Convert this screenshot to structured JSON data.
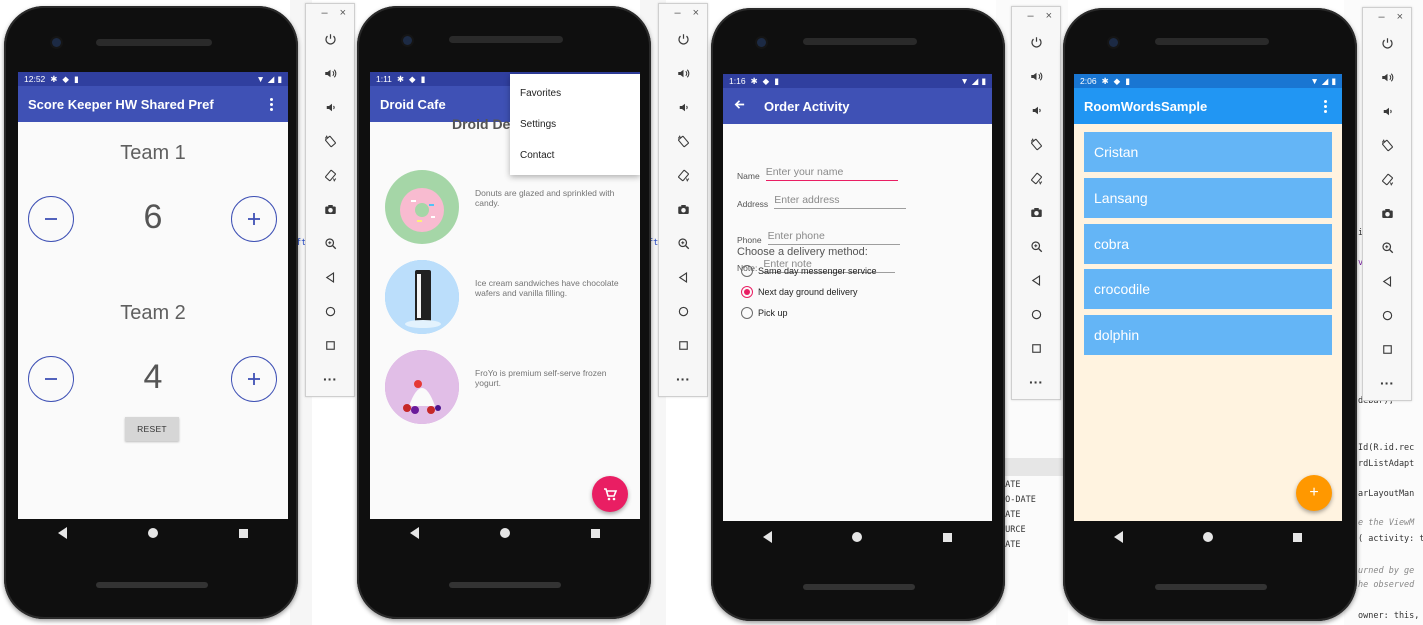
{
  "colors": {
    "indigo": "#3f51b5",
    "pink_accent": "#e91e63",
    "blue": "#2196f3",
    "word_bg": "#64b5f6",
    "room_bg": "#fff3e0",
    "orange_fab": "#ff9800"
  },
  "ide_fragments": [
    "ft",
    "ft",
    "DATE",
    "TO-DATE",
    "DATE",
    "OURCE",
    "DATE",
    "iv",
    "ve",
    "debar);",
    "Id(R.id.rec",
    "rdListAdapt",
    "arLayoutMan",
    "e the ViewM",
    "( activity: th",
    "urned by ge",
    "he observed",
    "owner: this,"
  ],
  "emulator_toolbar": {
    "minimize": "–",
    "close": "×",
    "buttons": [
      "power-icon",
      "volume-up-icon",
      "volume-down-icon",
      "rotate-left-icon",
      "rotate-right-icon",
      "camera-icon",
      "zoom-icon",
      "back-icon",
      "home-icon",
      "overview-icon",
      "more-icon"
    ],
    "more_label": "···"
  },
  "score_keeper": {
    "status_time": "12:52",
    "title": "Score Keeper HW Shared Pref",
    "team1_label": "Team 1",
    "team1_score": "6",
    "team2_label": "Team 2",
    "team2_score": "4",
    "reset_label": "RESET"
  },
  "droid_cafe": {
    "status_time": "1:11",
    "title": "Droid Cafe",
    "heading": "Droid De",
    "menu": [
      "Favorites",
      "Settings",
      "Contact"
    ],
    "desserts": [
      {
        "image": "donut",
        "text": "Donuts are glazed and sprinkled with candy."
      },
      {
        "image": "ice-cream-sandwich",
        "text": "Ice cream sandwiches have chocolate wafers and vanilla filling."
      },
      {
        "image": "froyo",
        "text": "FroYo is premium self-serve frozen yogurt."
      }
    ]
  },
  "order_activity": {
    "status_time": "1:16",
    "title": "Order Activity",
    "fields": [
      {
        "label": "Name",
        "placeholder": "Enter your name"
      },
      {
        "label": "Address",
        "placeholder": "Enter address"
      },
      {
        "label": "Phone",
        "placeholder": "Enter phone"
      },
      {
        "label": "Note:",
        "placeholder": "Enter note"
      }
    ],
    "delivery_label": "Choose a delivery method:",
    "options": [
      {
        "label": "Same day messenger service",
        "checked": false
      },
      {
        "label": "Next day ground delivery",
        "checked": true
      },
      {
        "label": "Pick up",
        "checked": false
      }
    ]
  },
  "room_words": {
    "status_time": "2:06",
    "title": "RoomWordsSample",
    "words": [
      "Cristan",
      "Lansang",
      "cobra",
      "crocodile",
      "dolphin"
    ],
    "fab_label": "+"
  }
}
